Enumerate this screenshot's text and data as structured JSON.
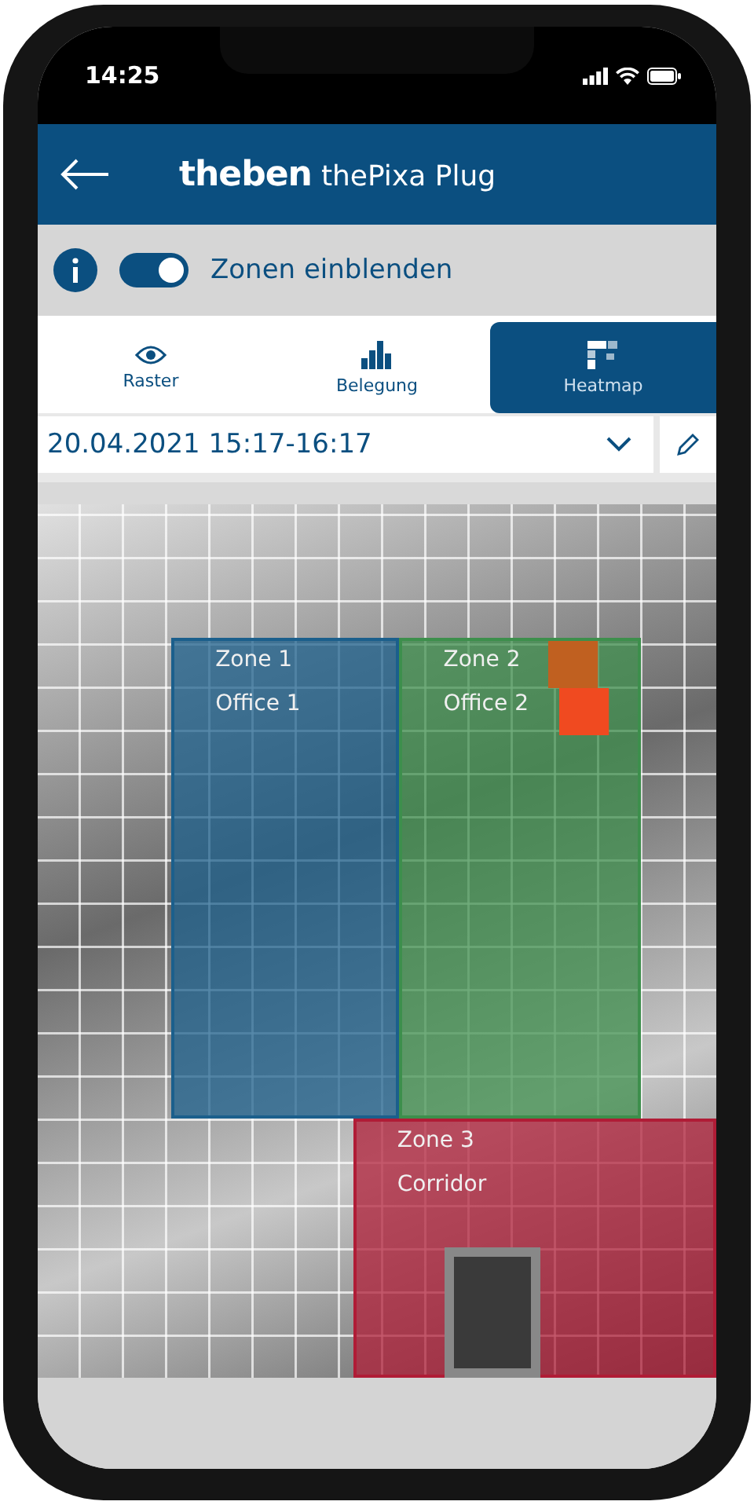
{
  "status_bar": {
    "time": "14:25"
  },
  "header": {
    "brand": "theben",
    "title": "thePixa Plug"
  },
  "zones_toggle": {
    "label": "Zonen einblenden",
    "on": true
  },
  "tabs": [
    {
      "label": "Raster",
      "kind": "eye",
      "selected": false
    },
    {
      "label": "Belegung",
      "kind": "bars",
      "selected": false
    },
    {
      "label": "Heatmap",
      "kind": "heat",
      "selected": true
    }
  ],
  "period": {
    "value": "20.04.2021 15:17-16:17"
  },
  "zones": [
    {
      "name": "Zone 1",
      "label": "Office 1",
      "color": "#1b5f8c"
    },
    {
      "name": "Zone 2",
      "label": "Office 2",
      "color": "#3d8f4c"
    },
    {
      "name": "Zone 3",
      "label": "Corridor",
      "color": "#b01c36"
    }
  ]
}
